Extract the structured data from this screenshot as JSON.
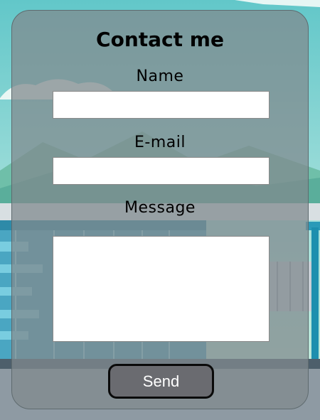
{
  "form": {
    "title": "Contact me",
    "name_label": "Name",
    "name_value": "",
    "email_label": "E-mail",
    "email_value": "",
    "message_label": "Message",
    "message_value": "",
    "send_label": "Send"
  },
  "colors": {
    "card_background": "#808a8e",
    "card_border": "#5f6b6f",
    "button_background": "#6a6b70",
    "button_border": "#0a0a0a",
    "button_text": "#ffffff",
    "field_background": "#ffffff"
  }
}
